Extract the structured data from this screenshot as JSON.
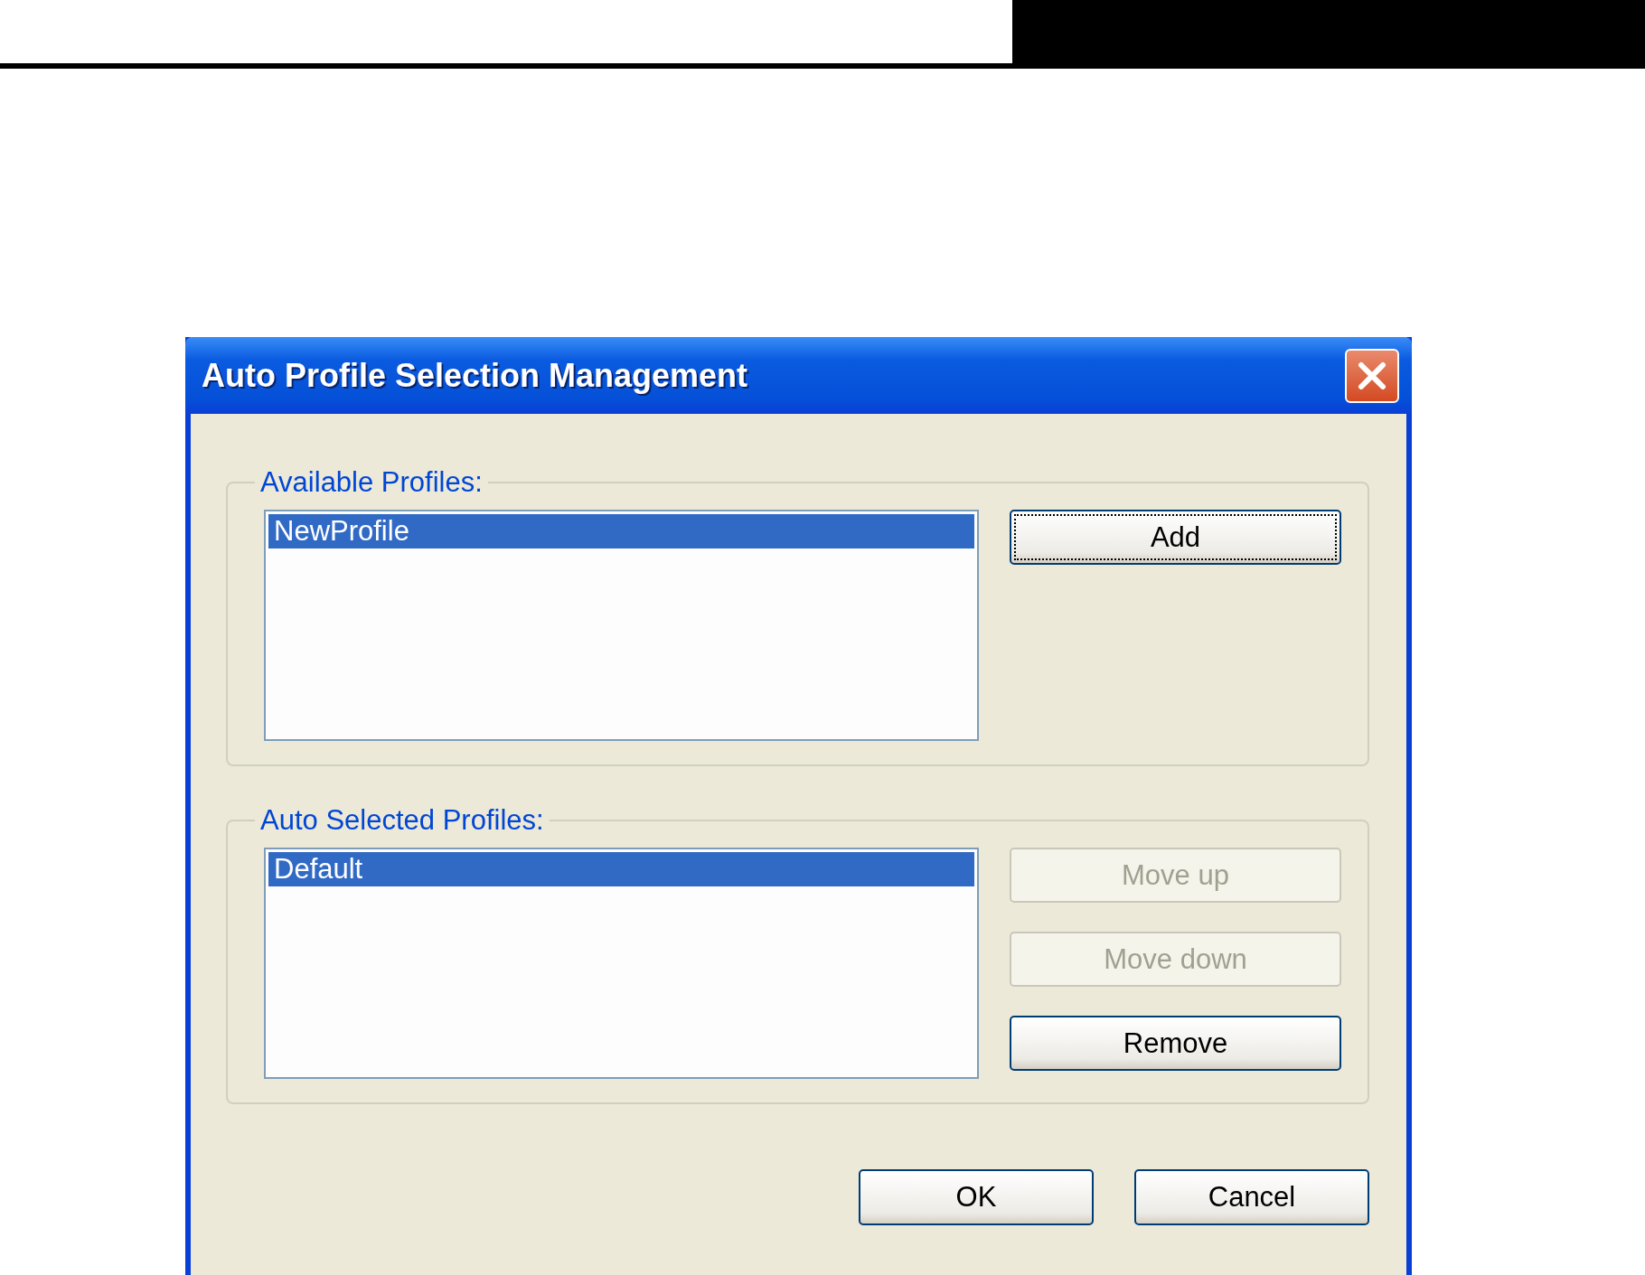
{
  "window": {
    "title": "Auto Profile Selection Management"
  },
  "groups": [
    {
      "legend": "Available Profiles:",
      "items": [
        {
          "label": "NewProfile",
          "selected": true
        }
      ],
      "buttons": [
        {
          "label": "Add",
          "disabled": false,
          "focused": true
        }
      ]
    },
    {
      "legend": "Auto Selected Profiles:",
      "items": [
        {
          "label": "Default",
          "selected": true
        }
      ],
      "buttons": [
        {
          "label": "Move up",
          "disabled": true,
          "focused": false
        },
        {
          "label": "Move down",
          "disabled": true,
          "focused": false
        },
        {
          "label": "Remove",
          "disabled": false,
          "focused": false
        }
      ]
    }
  ],
  "buttons": [
    {
      "label": "OK"
    },
    {
      "label": "Cancel"
    }
  ]
}
